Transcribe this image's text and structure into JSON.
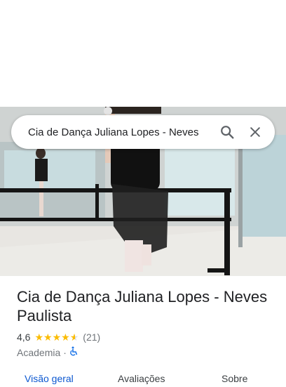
{
  "search": {
    "query": "Cia de Dança Juliana Lopes - Neves"
  },
  "icons": {
    "search": "search-icon",
    "close": "close-icon",
    "accessible": "wheelchair-accessible-icon",
    "star": "star-icon"
  },
  "place": {
    "name": "Cia de Dança Juliana Lopes - Neves Paulista",
    "rating": "4,6",
    "rating_fraction": 0.92,
    "review_count": "(21)",
    "category": "Academia",
    "separator": "·"
  },
  "tabs": [
    {
      "label": "Visão geral",
      "active": true
    },
    {
      "label": "Avaliações",
      "active": false
    },
    {
      "label": "Sobre",
      "active": false
    }
  ],
  "colors": {
    "accent": "#0b57d0",
    "star": "#fbbc04",
    "text": "#202124",
    "muted": "#70757a"
  }
}
